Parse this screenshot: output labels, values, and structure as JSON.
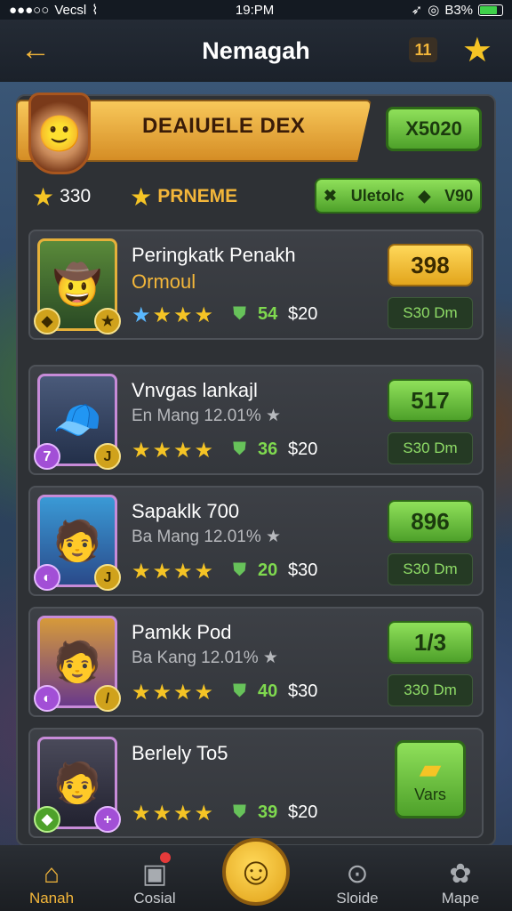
{
  "status": {
    "carrier": "Vecsl",
    "time": "19:PM",
    "battery": "B3%"
  },
  "header": {
    "title": "Nemagah",
    "level": "11"
  },
  "banner": {
    "title": "DEAIUELE DEX",
    "button": "X5020"
  },
  "summary": {
    "stars": "330",
    "label": "PRNEME",
    "match_label": "Uletolc",
    "match_value": "V90"
  },
  "list": [
    {
      "name": "Peringkatk Penakh",
      "sub": "Ormoul",
      "pts": "54",
      "price": "$20",
      "score": "398",
      "dur": "S30 Dm"
    },
    {
      "name": "Vnvgas lankajl",
      "sub": "En Mang 12.01% ★",
      "pts": "36",
      "price": "$20",
      "score": "517",
      "dur": "S30 Dm"
    },
    {
      "name": "Sapaklk 700",
      "sub": "Ba Mang 12.01% ★",
      "pts": "20",
      "price": "$30",
      "score": "896",
      "dur": "S30 Dm"
    },
    {
      "name": "Pamkk Pod",
      "sub": "Ba Kang 12.01% ★",
      "pts": "40",
      "price": "$30",
      "score": "1/3",
      "dur": "330 Dm"
    },
    {
      "name": "Berlely To5",
      "pts": "39",
      "price": "$20",
      "action": "Vars"
    }
  ],
  "nav": [
    {
      "label": "Nanah",
      "icon": "home-icon"
    },
    {
      "label": "Cosial",
      "icon": "notification-icon"
    },
    {
      "label": "Sloide",
      "icon": "search-icon"
    },
    {
      "label": "Mape",
      "icon": "map-icon"
    }
  ],
  "colors": {
    "accent": "#f3b63a",
    "green": "#4ea12a",
    "panel": "#2e3135"
  }
}
